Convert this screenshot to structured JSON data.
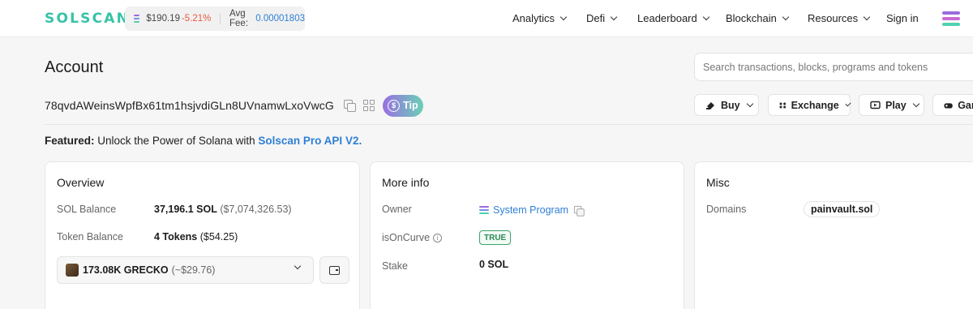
{
  "header": {
    "logo_text": "SOLSCAN",
    "price": "$190.19",
    "price_change": "-5.21%",
    "avg_fee_label": "Avg Fee:",
    "avg_fee_value": "0.00001803",
    "nav": [
      {
        "label": "Analytics"
      },
      {
        "label": "Defi"
      },
      {
        "label": "Leaderboard"
      },
      {
        "label": "Blockchain"
      },
      {
        "label": "Resources"
      }
    ],
    "sign_in": "Sign in",
    "menu_icon": "solana-menu-icon"
  },
  "page": {
    "title": "Account",
    "search_placeholder": "Search transactions, blocks, programs and tokens",
    "address": "78qvdAWeinsWpfBx61tm1hsjvdiGLn8UVnamwLxoVwcG",
    "tip_label": "Tip",
    "actions": [
      {
        "label": "Buy",
        "icon": "buy-icon"
      },
      {
        "label": "Exchange",
        "icon": "exchange-icon"
      },
      {
        "label": "Play",
        "icon": "play-icon"
      },
      {
        "label": "Gam",
        "icon": "gamepad-icon"
      }
    ],
    "featured_label": "Featured:",
    "featured_text": "Unlock the Power of Solana with",
    "featured_link": "Solscan Pro API V2."
  },
  "overview": {
    "title": "Overview",
    "sol_balance_label": "SOL Balance",
    "sol_balance_value": "37,196.1 SOL",
    "sol_balance_usd": "($7,074,326.53)",
    "token_balance_label": "Token Balance",
    "token_balance_value": "4 Tokens",
    "token_balance_usd": "($54.25)",
    "selected_token": "173.08K GRECKO",
    "selected_token_usd": "(~$29.76)"
  },
  "more_info": {
    "title": "More info",
    "owner_label": "Owner",
    "owner_value": "System Program",
    "is_on_curve_label": "isOnCurve",
    "is_on_curve_value": "TRUE",
    "stake_label": "Stake",
    "stake_value": "0 SOL"
  },
  "misc": {
    "title": "Misc",
    "domains_label": "Domains",
    "domain_value": "painvault.sol"
  },
  "colors": {
    "brand": "#36c3a7",
    "link": "#2f7fd6",
    "negative": "#e85b3e",
    "success": "#2a8a57"
  }
}
